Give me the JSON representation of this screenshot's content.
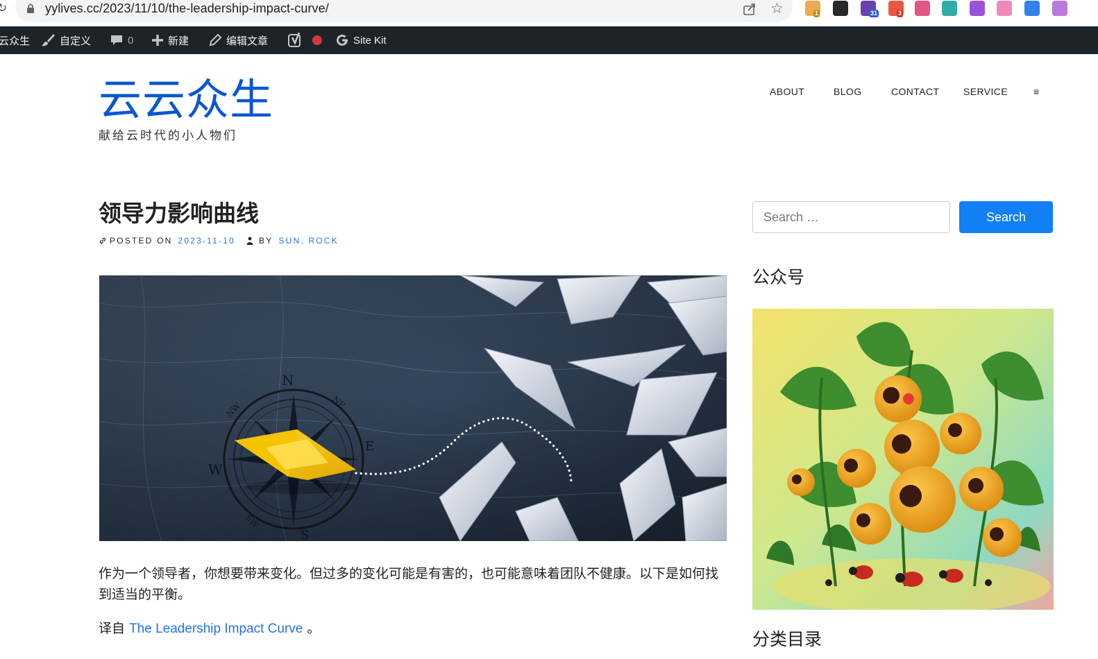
{
  "browser": {
    "url": "yylives.cc/2023/11/10/the-leadership-impact-curve/",
    "extensions": [
      {
        "name": "grammar-extension-icon",
        "color": "#e8a33d",
        "badge": "1",
        "badge_color": "#c08a1a"
      },
      {
        "name": "notion-icon",
        "color": "#111111",
        "badge": "",
        "badge_color": ""
      },
      {
        "name": "graduation-cap-icon",
        "color": "#5a2ea6",
        "badge": "31",
        "badge_color": "#2a5bd7"
      },
      {
        "name": "red-blob-extension-icon",
        "color": "#e8452f",
        "badge": "3",
        "badge_color": "#d93025"
      },
      {
        "name": "translate-extension-icon",
        "color": "#e0417a",
        "badge": "",
        "badge_color": ""
      },
      {
        "name": "teal-grid-extension-icon",
        "color": "#1aa39a",
        "badge": "",
        "badge_color": ""
      },
      {
        "name": "purple-circle-extension-icon",
        "color": "#8e3fd6",
        "badge": "",
        "badge_color": ""
      },
      {
        "name": "pink-cloud-extension-icon",
        "color": "#f07cb0",
        "badge": "",
        "badge_color": ""
      },
      {
        "name": "blue-feather-extension-icon",
        "color": "#1a73e8",
        "badge": "",
        "badge_color": ""
      },
      {
        "name": "openai-icon",
        "color": "#b36ad9",
        "badge": "",
        "badge_color": ""
      }
    ]
  },
  "admin_bar": {
    "site_name": "云众生",
    "customize_label": "自定义",
    "comments_count": "0",
    "new_label": "新建",
    "edit_label": "编辑文章",
    "site_kit_label": "Site Kit"
  },
  "site": {
    "title": "云云众生",
    "tagline": "献给云时代的小人物们"
  },
  "nav": {
    "items": [
      "ABOUT",
      "BLOG",
      "CONTACT",
      "SERVICE"
    ],
    "menu_glyph": "≡"
  },
  "post": {
    "title": "领导力影响曲线",
    "posted_on_label": "POSTED ON",
    "date": "2023-11-10",
    "by_label": "BY",
    "author": "SUN, ROCK",
    "compass_letters": [
      "N",
      "E",
      "S",
      "W",
      "NE",
      "NW",
      "SW"
    ],
    "excerpt": "作为一个领导者，你想要带来变化。但过多的变化可能是有害的，也可能意味着团队不健康。以下是如何找到适当的平衡。",
    "source_prefix": "译自",
    "source_link": "The Leadership Impact Curve",
    "source_suffix": "。"
  },
  "sidebar": {
    "search_placeholder": "Search …",
    "search_button": "Search",
    "widget_wechat_title": "公众号",
    "widget_categories_title": "分类目录"
  },
  "colors": {
    "accent": "#1180f5",
    "link": "#2271f0",
    "title_blue": "#0b57d0",
    "admin_bar": "#1d2327"
  }
}
